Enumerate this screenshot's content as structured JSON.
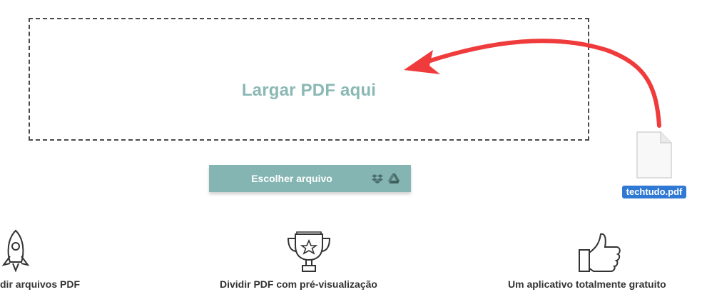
{
  "dropzone": {
    "label": "Largar PDF aqui"
  },
  "upload": {
    "button_label": "Escolher arquivo",
    "icons": [
      "dropbox-icon",
      "google-drive-icon"
    ]
  },
  "dragged_file": {
    "name": "techtudo.pdf",
    "icon": "document-icon"
  },
  "annotation": {
    "arrow_color": "#ef3b3b",
    "icon": "red-arrow"
  },
  "features": [
    {
      "label": "dir arquivos PDF",
      "icon": "rocket-icon"
    },
    {
      "label": "Dividir PDF com pré-visualização",
      "icon": "trophy-icon"
    },
    {
      "label": "Um aplicativo totalmente gratuito",
      "icon": "thumbs-up-icon"
    }
  ],
  "colors": {
    "accent": "#84b5b2",
    "drop_label": "#8ab8b5",
    "file_badge": "#2f78d4"
  }
}
